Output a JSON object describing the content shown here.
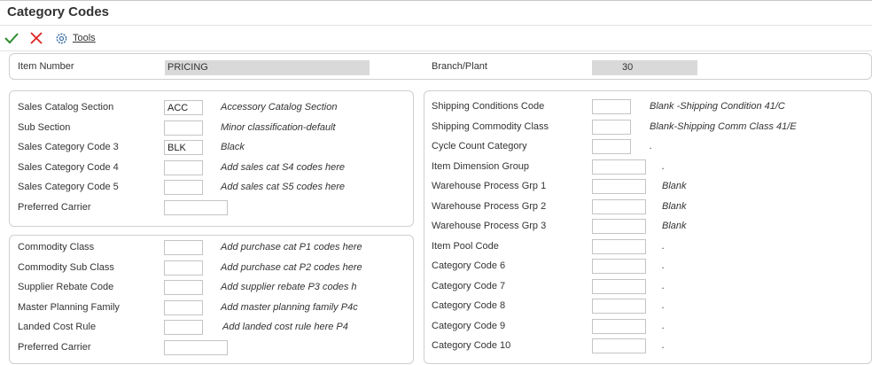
{
  "window": {
    "title": "Category Codes"
  },
  "toolbar": {
    "tools_label": "Tools"
  },
  "header": {
    "item_number_label": "Item Number",
    "item_number_value": "PRICING",
    "branch_label": "Branch/Plant",
    "branch_value": "30"
  },
  "sales": {
    "rows": [
      {
        "label": "Sales Catalog Section",
        "value": "ACC",
        "desc": "Accessory Catalog Section"
      },
      {
        "label": "Sub Section",
        "value": "",
        "desc": "Minor classification-default"
      },
      {
        "label": "Sales Category Code 3",
        "value": "BLK",
        "desc": "Black"
      },
      {
        "label": "Sales Category Code 4",
        "value": "",
        "desc": "Add sales cat S4 codes here"
      },
      {
        "label": "Sales Category Code 5",
        "value": "",
        "desc": "Add sales cat S5 codes here"
      },
      {
        "label": "Preferred Carrier",
        "value": "",
        "desc": ""
      }
    ]
  },
  "purchasing": {
    "rows": [
      {
        "label": "Commodity Class",
        "value": "",
        "desc": "Add purchase cat P1 codes here"
      },
      {
        "label": "Commodity Sub Class",
        "value": "",
        "desc": "Add purchase cat P2 codes here"
      },
      {
        "label": "Supplier Rebate Code",
        "value": "",
        "desc": "Add supplier rebate P3 codes h"
      },
      {
        "label": "Master Planning Family",
        "value": "",
        "desc": "Add master planning family P4c"
      },
      {
        "label": "Landed Cost Rule",
        "value": "",
        "desc": "Add landed cost rule here P4"
      },
      {
        "label": "Preferred Carrier",
        "value": "",
        "desc": ""
      }
    ]
  },
  "shipping": {
    "rows": [
      {
        "label": "Shipping Conditions Code",
        "value": "",
        "desc": "Blank -Shipping Condition 41/C"
      },
      {
        "label": "Shipping Commodity Class",
        "value": "",
        "desc": "Blank-Shipping Comm Class 41/E"
      },
      {
        "label": "Cycle Count Category",
        "value": "",
        "desc": "."
      },
      {
        "label": "Item Dimension Group",
        "value": "",
        "desc": "."
      },
      {
        "label": "Warehouse Process Grp 1",
        "value": "",
        "desc": "Blank"
      },
      {
        "label": "Warehouse Process Grp 2",
        "value": "",
        "desc": "Blank"
      },
      {
        "label": "Warehouse Process Grp 3",
        "value": "",
        "desc": "Blank"
      },
      {
        "label": "Item Pool Code",
        "value": "",
        "desc": "."
      },
      {
        "label": "Category Code 6",
        "value": "",
        "desc": "."
      },
      {
        "label": "Category Code 7",
        "value": "",
        "desc": "."
      },
      {
        "label": "Category Code 8",
        "value": "",
        "desc": "."
      },
      {
        "label": "Category Code 9",
        "value": "",
        "desc": "."
      },
      {
        "label": "Category Code 10",
        "value": "",
        "desc": "."
      }
    ]
  }
}
